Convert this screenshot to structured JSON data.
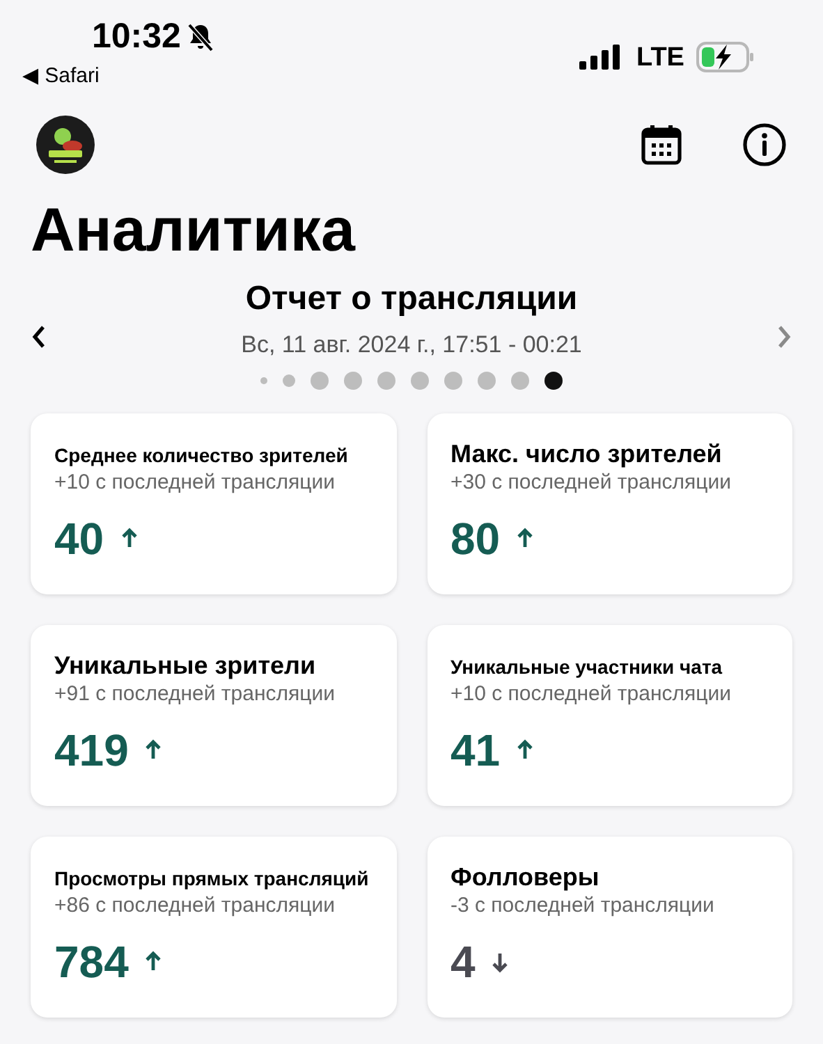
{
  "status_bar": {
    "time": "10:32",
    "back_app": "◀ Safari",
    "network": "LTE"
  },
  "header": {
    "title": "Аналитика"
  },
  "report": {
    "title": "Отчет о трансляции",
    "date": "Вс, 11 авг. 2024 г., 17:51 - 00:21",
    "pages": [
      {
        "selected": false
      },
      {
        "selected": false
      },
      {
        "selected": false
      },
      {
        "selected": false
      },
      {
        "selected": false
      },
      {
        "selected": false
      },
      {
        "selected": false
      },
      {
        "selected": false
      },
      {
        "selected": false
      },
      {
        "selected": true
      }
    ]
  },
  "cards": [
    {
      "title": "Среднее количество зрителей",
      "change": "+10 с последней трансляции",
      "value": "40",
      "kind": "up"
    },
    {
      "title": "Макс. число зрителей",
      "change": "+30 с последней трансляции",
      "value": "80",
      "kind": "up"
    },
    {
      "title": "Уникальные зрители",
      "change": "+91 с последней трансляции",
      "value": "419",
      "kind": "up"
    },
    {
      "title": "Уникальные участники чата",
      "change": "+10 с последней трансляции",
      "value": "41",
      "kind": "up"
    },
    {
      "title": "Просмотры прямых трансляций",
      "change": "+86 с последней трансляции",
      "value": "784",
      "kind": "up"
    },
    {
      "title": "Фолловеры",
      "change": "-3 с последней трансляции",
      "value": "4",
      "kind": "down"
    }
  ]
}
